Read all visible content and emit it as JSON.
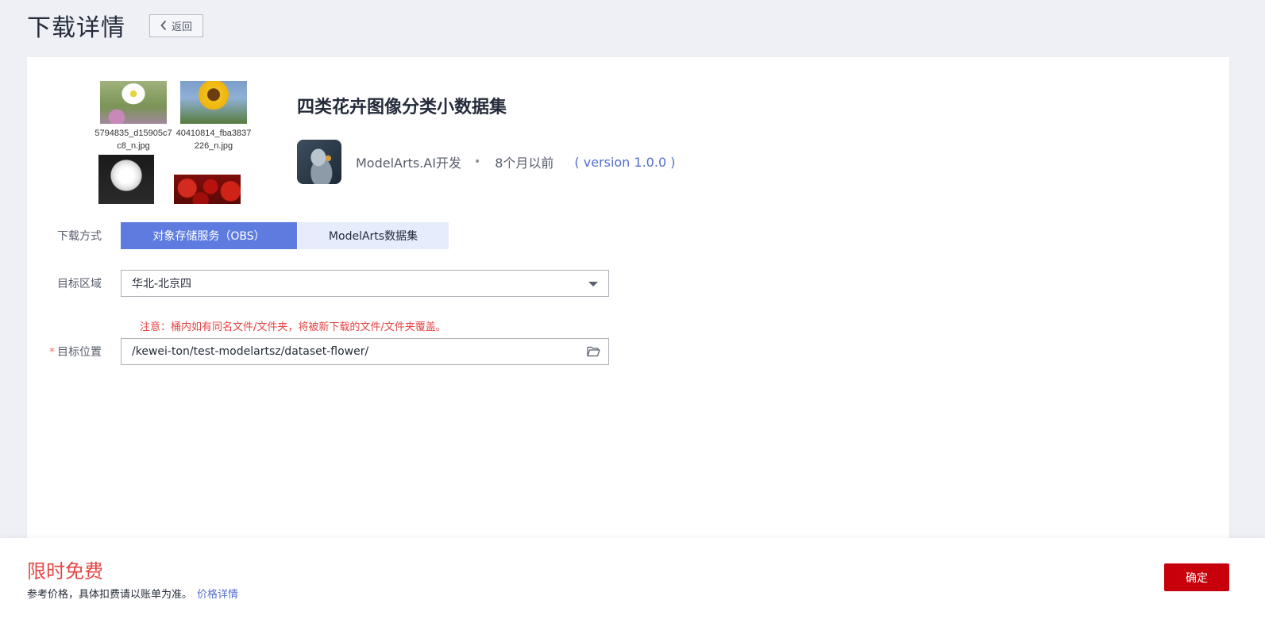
{
  "header": {
    "title": "下载详情",
    "back_label": "返回"
  },
  "dataset": {
    "name": "四类花卉图像分类小数据集",
    "publisher": "ModelArts.AI开发",
    "separator": "•",
    "updated": "8个月以前",
    "version": "( version 1.0.0 )",
    "thumbnails": [
      {
        "caption": "5794835_d15905c7c8_n.jpg",
        "icon": "daisy-image"
      },
      {
        "caption": "40410814_fba3837226_n.jpg",
        "icon": "sunflower-image"
      },
      {
        "caption": "",
        "icon": "dandelion-image"
      },
      {
        "caption": "",
        "icon": "roses-image"
      }
    ]
  },
  "form": {
    "download_method": {
      "label": "下载方式",
      "options": [
        "对象存储服务（OBS）",
        "ModelArts数据集"
      ],
      "selected": "对象存储服务（OBS）"
    },
    "target_region": {
      "label": "目标区域",
      "value": "华北-北京四"
    },
    "warning": "注意：桶内如有同名文件/文件夹，将被新下载的文件/文件夹覆盖。",
    "target_location": {
      "required_mark": "*",
      "label": "目标位置",
      "value": "/kewei-ton/test-modelartsz/dataset-flower/"
    }
  },
  "footer": {
    "price": "限时免费",
    "note": "参考价格，具体扣费请以账单为准。",
    "price_link": "价格详情",
    "confirm_label": "确定"
  },
  "colors": {
    "accent": "#5e7ce0",
    "link": "#526ecc",
    "danger": "#e54545",
    "confirm": "#c7000b",
    "background": "#eef0f5"
  }
}
